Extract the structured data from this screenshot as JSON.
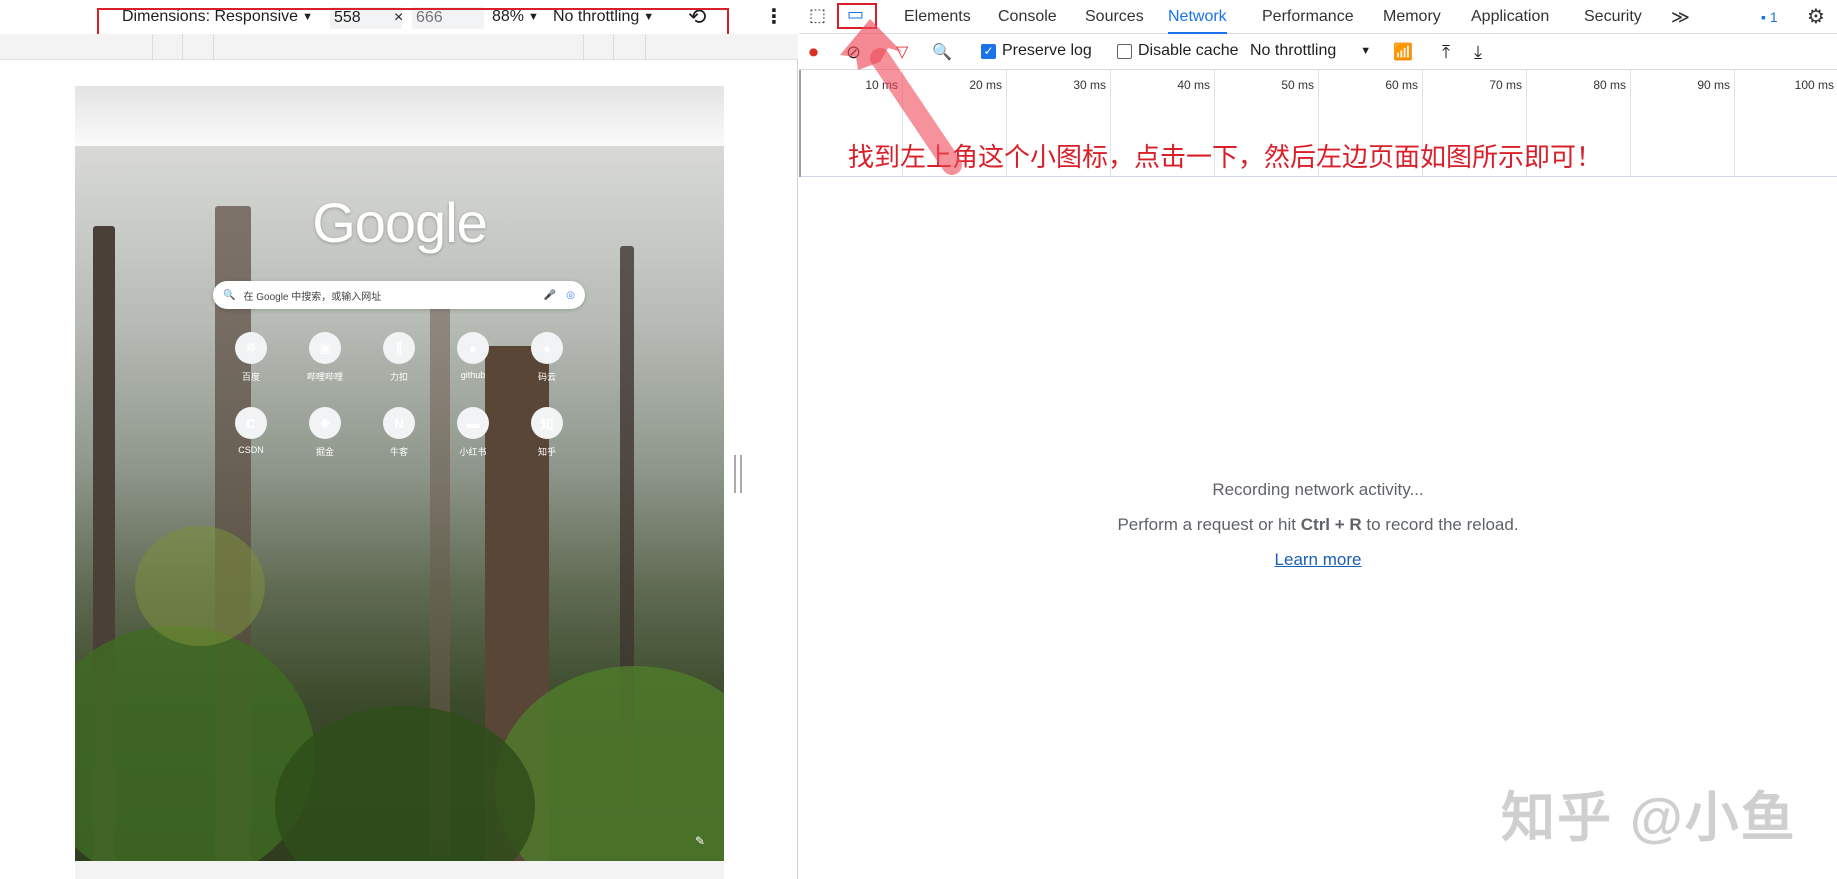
{
  "device_toolbar": {
    "dimensions_label": "Dimensions: Responsive",
    "width_value": "558",
    "times": "×",
    "height_placeholder": "666",
    "zoom": "88%",
    "throttling": "No throttling"
  },
  "google_page": {
    "logo": "Google",
    "search_placeholder": "在 Google 中搜索，或输入网址",
    "shortcuts_row1": [
      {
        "label": "百度",
        "icon": "baidu-icon",
        "glyph": "❁"
      },
      {
        "label": "哔哩哔哩",
        "icon": "bilibili-icon",
        "glyph": "▣"
      },
      {
        "label": "力扣",
        "icon": "leetcode-icon",
        "glyph": "∥"
      },
      {
        "label": "github",
        "icon": "github-icon",
        "glyph": "●"
      },
      {
        "label": "码云",
        "icon": "github-icon",
        "glyph": "●"
      }
    ],
    "shortcuts_row2": [
      {
        "label": "CSDN",
        "icon": "csdn-icon",
        "glyph": "C"
      },
      {
        "label": "掘金",
        "icon": "juejin-icon",
        "glyph": "◆"
      },
      {
        "label": "牛客",
        "icon": "nowcoder-icon",
        "glyph": "N"
      },
      {
        "label": "小红书",
        "icon": "xiaohongshu-icon",
        "glyph": "▬"
      },
      {
        "label": "知乎",
        "icon": "zhihu-icon",
        "glyph": "知"
      }
    ]
  },
  "devtools": {
    "tabs": [
      "Elements",
      "Console",
      "Sources",
      "Network",
      "Performance",
      "Memory",
      "Application",
      "Security"
    ],
    "active_tab": "Network",
    "more_tabs": "≫",
    "issues_count": "1",
    "toolbar": {
      "preserve_log": "Preserve log",
      "disable_cache": "Disable cache",
      "throttling": "No throttling"
    },
    "timeline_labels": [
      "10 ms",
      "20 ms",
      "30 ms",
      "40 ms",
      "50 ms",
      "60 ms",
      "70 ms",
      "80 ms",
      "90 ms",
      "100 ms"
    ],
    "empty_state": {
      "title": "Recording network activity...",
      "hint_before": "Perform a request or hit ",
      "hint_key": "Ctrl + R",
      "hint_after": " to record the reload.",
      "link": "Learn more"
    }
  },
  "annotation": {
    "note": "找到左上角这个小图标，点击一下，然后左边页面如图所示即可！",
    "color": "#d9202a"
  },
  "watermark": "知乎 @小鱼"
}
